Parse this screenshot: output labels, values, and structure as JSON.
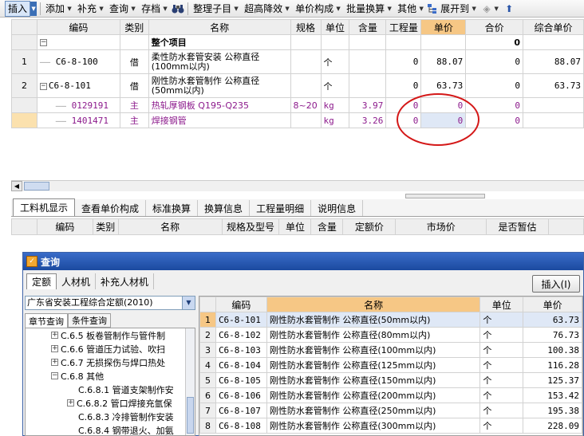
{
  "toolbar": {
    "insert": "插入",
    "add": "添加",
    "supplement": "补充",
    "query": "查询",
    "archive": "存档",
    "organize": "整理子目",
    "height_fee": "超高降效",
    "price_composition": "单价构成",
    "batch_convert": "批量换算",
    "other": "其他",
    "expand_to": "展开到"
  },
  "top_grid": {
    "headers": [
      "编码",
      "类别",
      "名称",
      "规格",
      "单位",
      "含量",
      "工程量",
      "单价",
      "合价",
      "综合单价"
    ],
    "summary": {
      "name": "整个项目",
      "total": "0"
    },
    "rows": [
      {
        "no": "1",
        "code": "C6-8-100",
        "type": "借",
        "name": "柔性防水套管安装 公称直径(100mm以内)",
        "spec": "",
        "unit": "个",
        "content": "",
        "qty": "0",
        "price": "88.07",
        "total": "0",
        "unit_total": "88.07"
      },
      {
        "no": "2",
        "code": "C6-8-101",
        "type": "借",
        "name": "刚性防水套管制作 公称直径(50mm以内)",
        "spec": "",
        "unit": "个",
        "content": "",
        "qty": "0",
        "price": "63.73",
        "total": "0",
        "unit_total": "63.73"
      },
      {
        "no": "",
        "code": "0129191",
        "type": "主",
        "name": "热轧厚钢板 Q195-Q235",
        "spec": "8~20",
        "unit": "kg",
        "content": "3.97",
        "qty": "0",
        "price": "0",
        "total": "0",
        "unit_total": ""
      },
      {
        "no": "",
        "code": "1401471",
        "type": "主",
        "name": "焊接钢管",
        "spec": "",
        "unit": "kg",
        "content": "3.26",
        "qty": "0",
        "price": "0",
        "total": "0",
        "unit_total": ""
      }
    ]
  },
  "bottom_tabs": [
    "工料机显示",
    "查看单价构成",
    "标准换算",
    "换算信息",
    "工程量明细",
    "说明信息"
  ],
  "bottom_grid_headers": [
    "编码",
    "类别",
    "名称",
    "规格及型号",
    "单位",
    "含量",
    "定额价",
    "市场价",
    "是否暂估"
  ],
  "dialog": {
    "title": "查询",
    "tabs": [
      "定额",
      "人材机",
      "补充人材机"
    ],
    "insert_button": "插入(I)",
    "library": "广东省安装工程综合定额(2010)",
    "subtabs": [
      "章节查询",
      "条件查询"
    ],
    "tree": [
      {
        "indent": 1,
        "toggle": "+",
        "label": "C.6.5 板卷管制作与管件制"
      },
      {
        "indent": 1,
        "toggle": "+",
        "label": "C.6.6 管道压力试验、吹扫"
      },
      {
        "indent": 1,
        "toggle": "+",
        "label": "C.6.7 无损探伤与焊口热处"
      },
      {
        "indent": 1,
        "toggle": "-",
        "label": "C.6.8 其他"
      },
      {
        "indent": 2,
        "toggle": "",
        "label": "C.6.8.1 管道支架制作安"
      },
      {
        "indent": 2,
        "toggle": "+",
        "label": "C.6.8.2 管口焊接充氩保"
      },
      {
        "indent": 2,
        "toggle": "",
        "label": "C.6.8.3 冷排管制作安装"
      },
      {
        "indent": 2,
        "toggle": "",
        "label": "C.6.8.4 钢带退火、加氨"
      }
    ],
    "grid_headers": [
      "编码",
      "名称",
      "单位",
      "单价"
    ],
    "rows": [
      {
        "no": "1",
        "code": "C6-8-101",
        "name": "刚性防水套管制作 公称直径(50mm以内)",
        "unit": "个",
        "price": "63.73"
      },
      {
        "no": "2",
        "code": "C6-8-102",
        "name": "刚性防水套管制作 公称直径(80mm以内)",
        "unit": "个",
        "price": "76.73"
      },
      {
        "no": "3",
        "code": "C6-8-103",
        "name": "刚性防水套管制作 公称直径(100mm以内)",
        "unit": "个",
        "price": "100.38"
      },
      {
        "no": "4",
        "code": "C6-8-104",
        "name": "刚性防水套管制作 公称直径(125mm以内)",
        "unit": "个",
        "price": "116.28"
      },
      {
        "no": "5",
        "code": "C6-8-105",
        "name": "刚性防水套管制作 公称直径(150mm以内)",
        "unit": "个",
        "price": "125.37"
      },
      {
        "no": "6",
        "code": "C6-8-106",
        "name": "刚性防水套管制作 公称直径(200mm以内)",
        "unit": "个",
        "price": "153.42"
      },
      {
        "no": "7",
        "code": "C6-8-107",
        "name": "刚性防水套管制作 公称直径(250mm以内)",
        "unit": "个",
        "price": "195.38"
      },
      {
        "no": "8",
        "code": "C6-8-108",
        "name": "刚性防水套管制作 公称直径(300mm以内)",
        "unit": "个",
        "price": "228.09"
      }
    ]
  }
}
